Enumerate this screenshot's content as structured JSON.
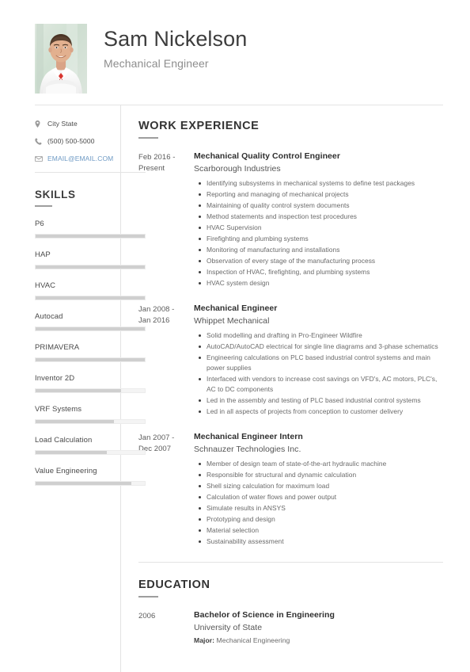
{
  "header": {
    "name": "Sam Nickelson",
    "job_title": "Mechanical Engineer",
    "photo_alt": "portrait-photo"
  },
  "contact": {
    "location": "City State",
    "phone": "(500) 500-5000",
    "email": "EMAIL@EMAIL.COM",
    "email_color": "#6e9ac4"
  },
  "skills": {
    "heading": "SKILLS",
    "items": [
      {
        "label": "P6",
        "level": 100
      },
      {
        "label": "HAP",
        "level": 100
      },
      {
        "label": "HVAC",
        "level": 100
      },
      {
        "label": "Autocad",
        "level": 100
      },
      {
        "label": "PRIMAVERA",
        "level": 100
      },
      {
        "label": "Inventor 2D",
        "level": 78
      },
      {
        "label": "VRF Systems",
        "level": 72
      },
      {
        "label": "Load Calculation",
        "level": 65
      },
      {
        "label": "Value Engineering",
        "level": 88
      }
    ]
  },
  "work_experience": {
    "heading": "WORK EXPERIENCE",
    "entries": [
      {
        "date": "Feb 2016 - Present",
        "role": "Mechanical Quality Control Engineer",
        "org": "Scarborough Industries",
        "bullets": [
          "Identifying subsystems in mechanical systems to define test packages",
          "Reporting and managing of mechanical projects",
          "Maintaining of quality control system documents",
          "Method statements and inspection test procedures",
          "HVAC Supervision",
          "Firefighting and plumbing systems",
          "Monitoring of manufacturing and installations",
          "Observation of every stage of the manufacturing process",
          "Inspection of HVAC, firefighting, and plumbing systems",
          "HVAC system design"
        ]
      },
      {
        "date": "Jan 2008 - Jan 2016",
        "role": "Mechanical Engineer",
        "org": "Whippet Mechanical",
        "bullets": [
          "Solid modelling and drafting in Pro-Engineer Wildfire",
          "AutoCAD/AutoCAD electrical for single line diagrams and 3-phase schematics",
          "Engineering calculations on PLC based industrial control systems and main power supplies",
          "Interfaced with vendors to increase cost savings on VFD's, AC motors, PLC's, AC to DC components",
          "Led in the assembly and testing of PLC based industrial control systems",
          "Led in all aspects of projects from conception to customer delivery"
        ]
      },
      {
        "date": "Jan 2007 - Dec 2007",
        "role": "Mechanical Engineer Intern",
        "org": "Schnauzer Technologies Inc.",
        "bullets": [
          "Member of design team of state-of-the-art hydraulic machine",
          "Responsible for structural and dynamic calculation",
          "Shell sizing calculation for maximum load",
          "Calculation of water flows and power output",
          "Simulate results in ANSYS",
          "Prototyping and design",
          "Material selection",
          "Sustainability assessment"
        ]
      }
    ]
  },
  "education": {
    "heading": "EDUCATION",
    "entries": [
      {
        "date": "2006",
        "degree": "Bachelor of Science in Engineering",
        "school": "University of State",
        "major_label": "Major:",
        "major_value": " Mechanical Engineering"
      }
    ]
  },
  "icons": {
    "location": "location-pin-icon",
    "phone": "phone-icon",
    "email": "envelope-icon"
  }
}
